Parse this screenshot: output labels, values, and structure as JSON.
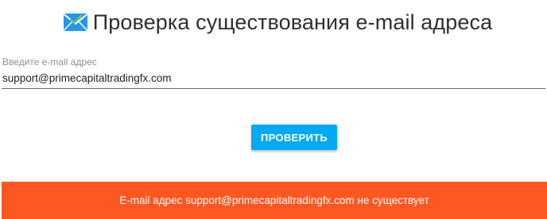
{
  "header": {
    "icon": "envelope-check-icon",
    "title": "Проверка существования e-mail адреса"
  },
  "form": {
    "email_label": "Введите e-mail адрес",
    "email_value": "support@primecapitaltradingfx.com",
    "check_button_label": "ПРОВЕРИТЬ"
  },
  "result": {
    "message": "E-mail адрес support@primecapitaltradingfx.com не существует"
  },
  "colors": {
    "accent_button": "#03a9f4",
    "result_bar": "#ff5722",
    "icon_blue": "#1e88e5",
    "icon_check": "#8bc34a"
  }
}
